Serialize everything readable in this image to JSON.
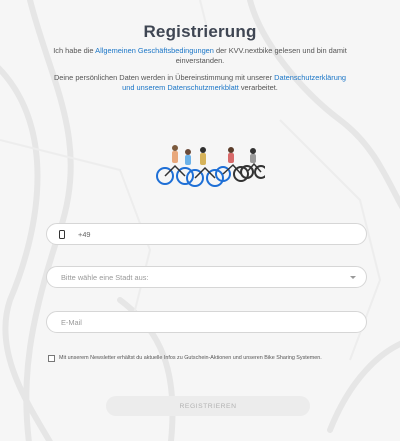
{
  "page": {
    "title": "Registrierung"
  },
  "consent": {
    "prefix": "Ich habe die ",
    "terms_link": "Allgemeinen Geschäftsbedingungen",
    "suffix": " der KVV.nextbike gelesen und bin damit einverstanden."
  },
  "privacy": {
    "prefix": "Deine persönlichen Daten werden in Übereinstimmung mit unserer ",
    "link": "Datenschutzerklärung und unserem Datenschutzmerkblatt",
    "suffix": " verarbeitet."
  },
  "form": {
    "phone": {
      "value": "+49",
      "icon": "phone-icon"
    },
    "city": {
      "placeholder": "Bitte wähle eine Stadt aus:",
      "icon": "chevron-down-icon"
    },
    "email": {
      "placeholder": "E-Mail"
    },
    "newsletter": {
      "label": "Mit unserem Newsletter erhältst du aktuelle Infos zu Gutschein-Aktionen und unseren Bike Sharing Systemen.",
      "checked": false
    },
    "submit_label": "REGISTRIEREN"
  },
  "colors": {
    "link": "#1b76c7",
    "title": "#3f4653",
    "bike_blue": "#1e6fd6"
  }
}
